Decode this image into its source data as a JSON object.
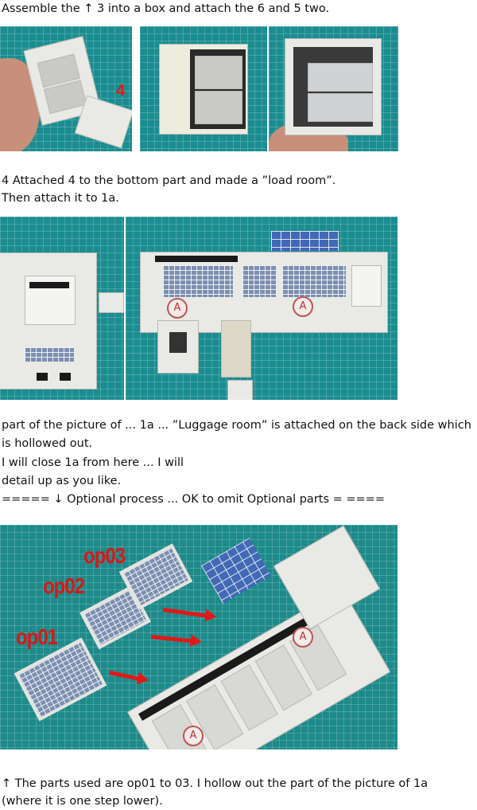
{
  "paragraphs": {
    "p1": "Assemble the  ↑  3 into a box and attach the 6 and 5 two.",
    "p2": "4 Attached 4 to the bottom part and made a ”load room”.",
    "p3": "Then attach it to 1a.",
    "p4": "part of the picture of ... 1a ... ”Luggage room” is attached on the back side which",
    "p5": "is hollowed out.",
    "p6": "I will close 1a from here ... I will",
    "p7": "detail up as you like.",
    "p8": "=====  ↓  Optional process ... OK to omit Optional parts = ====",
    "p9": "↑  The parts used are op01 to 03. I hollow out the part of the picture of 1a",
    "p10": "(where it is one step lower)."
  },
  "photo_labels": {
    "step_number": "4",
    "seat_letter": "A",
    "op01": "op01",
    "op02": "op02",
    "op03": "op03"
  },
  "colors": {
    "cutting_mat": "#1b8d91",
    "paper": "#e9e9e6",
    "annotation_red": "#e21818",
    "solar_blue": "#4169b5"
  }
}
